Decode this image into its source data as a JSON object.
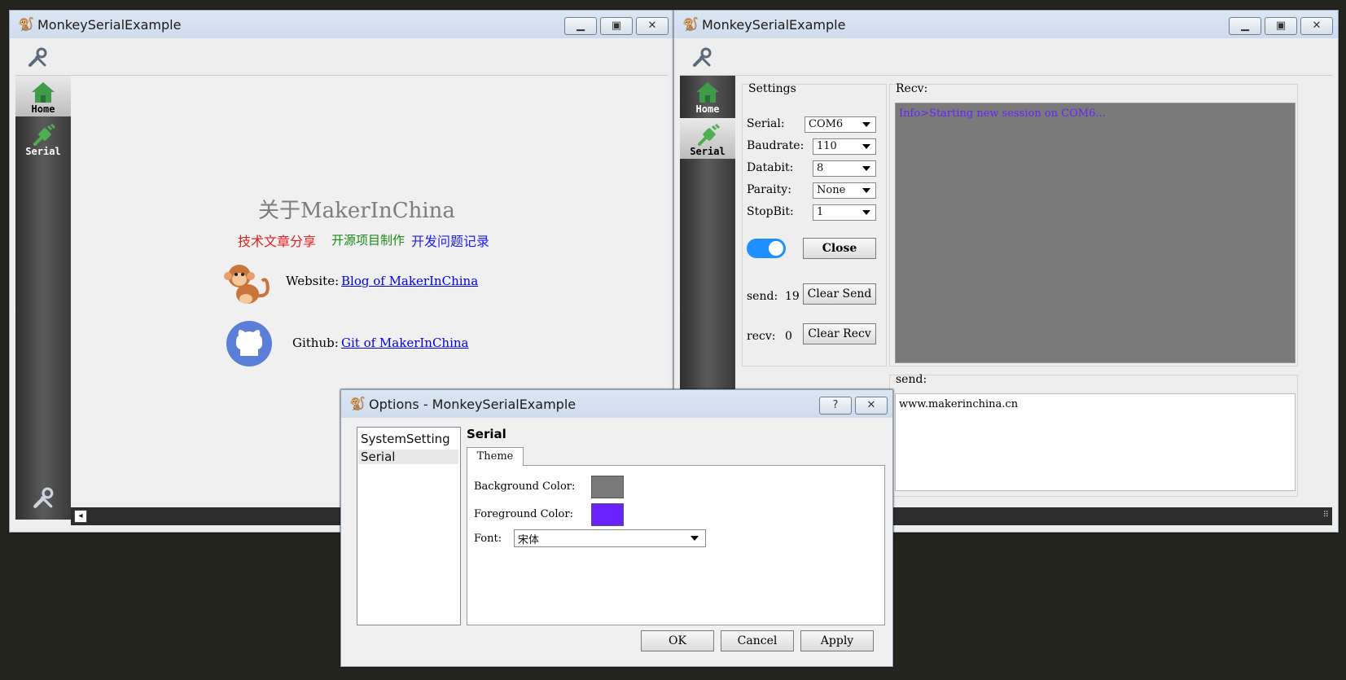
{
  "window1": {
    "title": "MonkeySerialExample",
    "buttons": {
      "min": "▁",
      "max": "▣",
      "close": "✕"
    },
    "sidebar": {
      "home": "Home",
      "serial": "Serial"
    },
    "about": {
      "title": "关于MakerInChina",
      "tag1": "技术文章分享",
      "tag2": "开源项目制作",
      "tag3": "开发问题记录",
      "website_label": "Website:",
      "website_link": "Blog of MakerInChina",
      "github_label": "Github:",
      "github_link": "Git of MakerInChina"
    }
  },
  "window2": {
    "title": "MonkeySerialExample",
    "buttons": {
      "min": "▁",
      "max": "▣",
      "close": "✕"
    },
    "sidebar": {
      "home": "Home",
      "serial": "Serial"
    },
    "settings": {
      "title": "Settings",
      "serial_label": "Serial:",
      "serial_value": "COM6",
      "baud_label": "Baudrate:",
      "baud_value": "110",
      "databit_label": "Databit:",
      "databit_value": "8",
      "parity_label": "Paraity:",
      "parity_value": "None",
      "stopbit_label": "StopBit:",
      "stopbit_value": "1",
      "toggle_on": true,
      "close_button": "Close",
      "send_label": "send:",
      "send_count": "19",
      "clear_send": "Clear Send",
      "recv_label": "recv:",
      "recv_count": "0",
      "clear_recv": "Clear Recv"
    },
    "recv": {
      "label": "Recv:",
      "text": "Info>Starting new session on COM6..."
    },
    "send": {
      "label": "send:",
      "text": "www.makerinchina.cn"
    }
  },
  "dialog": {
    "title": "Options - MonkeySerialExample",
    "help": "?",
    "close": "✕",
    "categories": [
      "SystemSetting",
      "Serial"
    ],
    "section": "Serial",
    "tab": "Theme",
    "bg_label": "Background Color:",
    "fg_label": "Foreground Color:",
    "font_label": "Font:",
    "font_value": "宋体",
    "ok": "OK",
    "cancel": "Cancel",
    "apply": "Apply"
  },
  "colors": {
    "background": "#7a7a7a",
    "foreground": "#6a22ff",
    "accent": "#1e90ff"
  }
}
